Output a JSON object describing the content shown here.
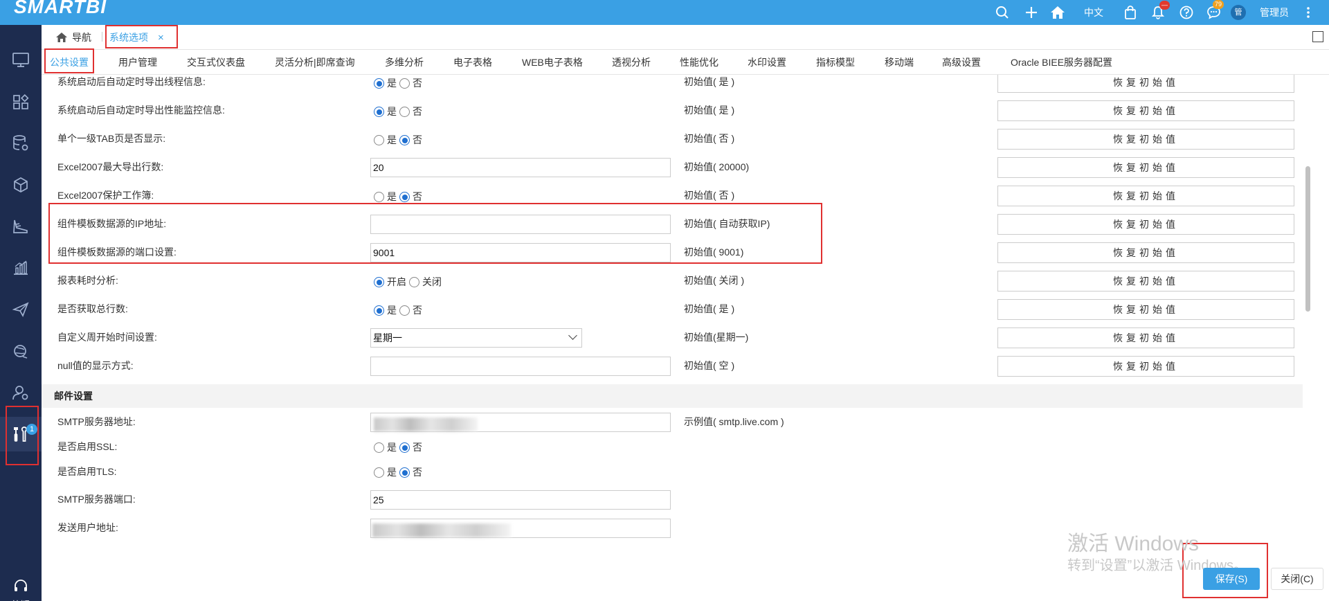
{
  "brand": {
    "logo": "SMARTBI"
  },
  "topbar": {
    "lang_label": "中文",
    "notification_badge": "—",
    "message_badge": "79",
    "avatar_text": "管",
    "user_name": "管理员"
  },
  "sidebar": {
    "tools_badge": "1",
    "help_label": "答疑"
  },
  "tabs": {
    "home_label": "导航",
    "active_tab": "系统选项",
    "close_symbol": "×"
  },
  "subtabs": [
    "公共设置",
    "用户管理",
    "交互式仪表盘",
    "灵活分析|即席查询",
    "多维分析",
    "电子表格",
    "WEB电子表格",
    "透视分析",
    "性能优化",
    "水印设置",
    "指标模型",
    "移动端",
    "高级设置",
    "Oracle BIEE服务器配置"
  ],
  "restore_label": "恢复初始值",
  "rows": [
    {
      "label": "系统启动后自动定时导出线程信息:",
      "opt1": "是",
      "opt2": "否",
      "init": "初始值( 是 )"
    },
    {
      "label": "系统启动后自动定时导出性能监控信息:",
      "opt1": "是",
      "opt2": "否",
      "init": "初始值( 是 )"
    },
    {
      "label": "单个一级TAB页是否显示:",
      "opt1": "是",
      "opt2": "否",
      "init": "初始值( 否 )"
    },
    {
      "label": "Excel2007最大导出行数:",
      "value": "20",
      "init": "初始值( 20000)"
    },
    {
      "label": "Excel2007保护工作簿:",
      "opt1": "是",
      "opt2": "否",
      "init": "初始值( 否 )"
    },
    {
      "label": "组件模板数据源的IP地址:",
      "value": "",
      "init": "初始值( 自动获取IP)"
    },
    {
      "label": "组件模板数据源的端口设置:",
      "value": "9001",
      "init": "初始值( 9001)"
    },
    {
      "label": "报表耗时分析:",
      "opt1": "开启",
      "opt2": "关闭",
      "init": "初始值( 关闭 )"
    },
    {
      "label": "是否获取总行数:",
      "opt1": "是",
      "opt2": "否",
      "init": "初始值( 是 )"
    },
    {
      "label": "自定义周开始时间设置:",
      "value": "星期一",
      "init": "初始值(星期一)"
    },
    {
      "label": "null值的显示方式:",
      "value": "",
      "init": "初始值( 空 )"
    }
  ],
  "mail": {
    "section_title": "邮件设置",
    "smtp_server_label": "SMTP服务器地址:",
    "smtp_server_example": "示例值( smtp.live.com )",
    "ssl_label": "是否启用SSL:",
    "tls_label": "是否启用TLS:",
    "opt_yes": "是",
    "opt_no": "否",
    "port_label": "SMTP服务器端口:",
    "port_value": "25",
    "sender_label": "发送用户地址:"
  },
  "watermark": {
    "line1": "激活 Windows",
    "line2": "转到“设置”以激活 Windows。"
  },
  "footer": {
    "save_label": "保存(S)",
    "close_label": "关闭(C)"
  },
  "colors": {
    "accent": "#3aa0e4",
    "sidebar": "#1d2c4f",
    "highlight": "#e03030"
  }
}
